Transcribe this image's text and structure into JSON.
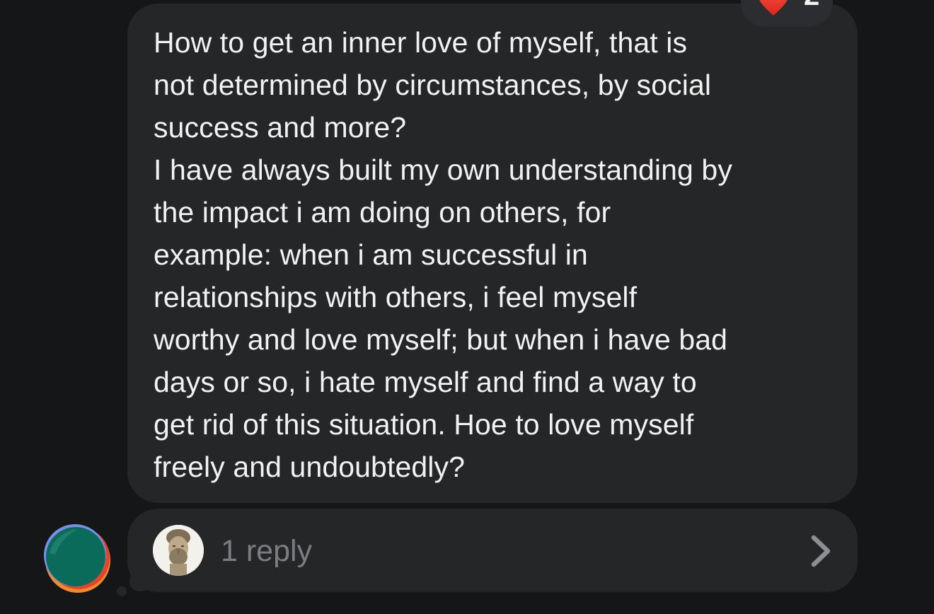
{
  "message": {
    "lines": [
      "How to get an inner love of myself, that is",
      "not determined by circumstances, by social",
      "success and more?",
      "I have always built my own understanding by",
      "the impact i am doing on others, for",
      "example: when i am successful in",
      "relationships with others, i feel myself",
      "worthy and love myself; but when i have bad",
      "days or so, i hate myself and find a way to",
      "get rid of this situation. Hoe to love myself",
      "freely and undoubtedly?"
    ]
  },
  "reaction": {
    "icon": "heart-icon",
    "count": "2",
    "color": "#e8392c"
  },
  "thread": {
    "reply_label": "1 reply",
    "replier_avatar": "marble-bust-avatar",
    "chevron": "chevron-right-icon"
  },
  "sender": {
    "avatar": "green-orange-circle-avatar"
  },
  "colors": {
    "background": "#151617",
    "bubble": "#252628",
    "text": "#f2f2f2",
    "muted": "#7c7d81"
  }
}
